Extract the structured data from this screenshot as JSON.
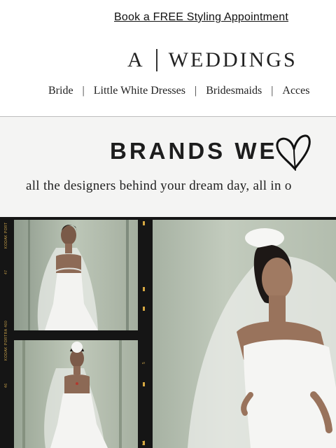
{
  "promo": {
    "text": "Book a FREE Styling Appointment"
  },
  "logo": {
    "left": "A",
    "right": "WEDDINGS"
  },
  "nav": {
    "items": [
      "Bride",
      "Little White Dresses",
      "Bridesmaids",
      "Acces"
    ],
    "separator": "|"
  },
  "banner": {
    "title": "BRANDS WE",
    "subtitle": "all the designers behind your dream day, all in o",
    "heart_icon": "heart-scribble-icon"
  },
  "film": {
    "edge_labels": [
      "KODAK PORT",
      "47",
      "KODAK PORTRA 400",
      "46",
      "5",
      "5A"
    ]
  },
  "colors": {
    "banner_bg": "#f4f4f3",
    "film_bg": "#151515",
    "film_mark": "#c9a24a"
  }
}
